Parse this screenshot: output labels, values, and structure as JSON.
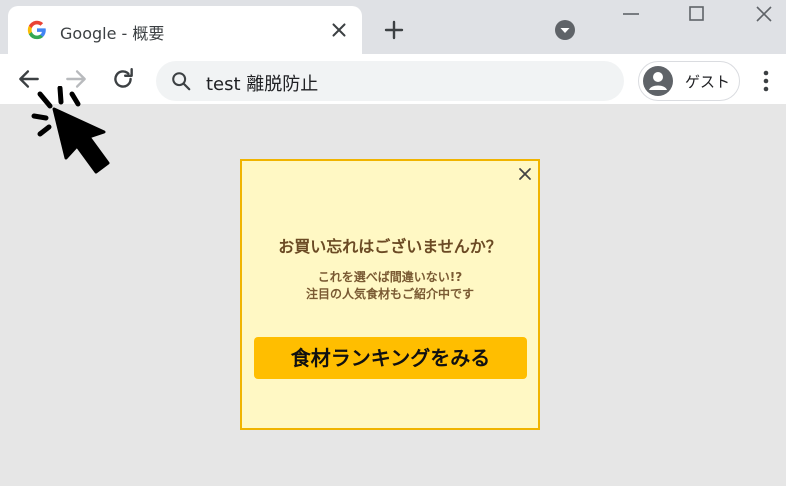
{
  "browser": {
    "tab_title": "Google - 概要",
    "omnibox_text": "test 離脱防止",
    "profile_label": "ゲスト"
  },
  "icons": {
    "favicon": "google-g-icon",
    "tab_close": "close-icon",
    "new_tab": "plus-icon",
    "tab_search": "dropdown-icon",
    "back": "back-arrow-icon",
    "forward": "forward-arrow-icon",
    "reload": "reload-icon",
    "search": "search-icon",
    "avatar": "guest-avatar-icon",
    "menu": "kebab-menu-icon",
    "cursor": "click-cursor-icon"
  },
  "popup": {
    "title": "お買い忘れはございませんか？",
    "text_line1": "これを選べば間違いない!?",
    "text_line2": "注目の人気食材もご紹介中です",
    "cta_label": "食材ランキングをみる"
  },
  "colors": {
    "popup_background": "#fff8c4",
    "popup_border": "#f0b400",
    "cta_background": "#ffbe00",
    "title_text": "#6b4a24"
  }
}
